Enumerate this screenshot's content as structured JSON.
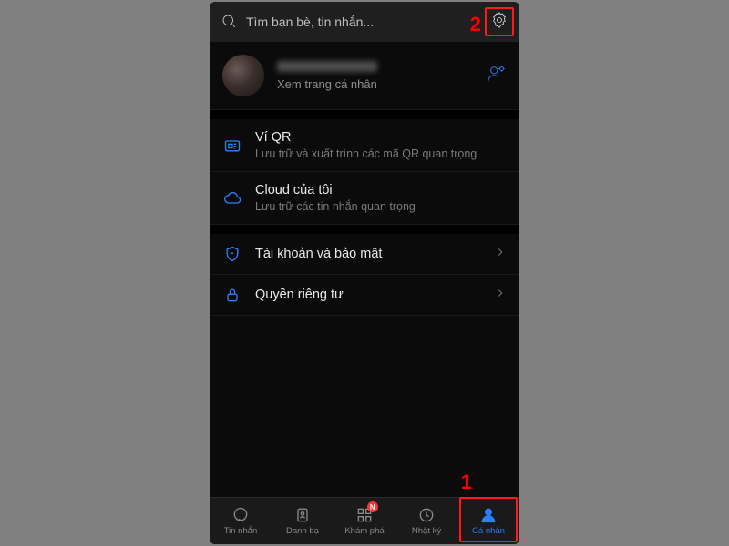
{
  "header": {
    "search_placeholder": "Tìm bạn bè, tin nhắn...",
    "annotation_top": "2"
  },
  "profile": {
    "subtitle": "Xem trang cá nhân"
  },
  "items": {
    "qr": {
      "title": "Ví QR",
      "sub": "Lưu trữ và xuất trình các mã QR quan trọng"
    },
    "cloud": {
      "title": "Cloud của tôi",
      "sub": "Lưu trữ các tin nhắn quan trọng"
    },
    "security": {
      "title": "Tài khoản và bảo mật"
    },
    "privacy": {
      "title": "Quyền riêng tư"
    }
  },
  "tabs": {
    "messages": "Tin nhắn",
    "contacts": "Danh bạ",
    "discover": "Khám phá",
    "discover_badge": "N",
    "diary": "Nhật ký",
    "me": "Cá nhân"
  },
  "annotation_bottom": "1"
}
